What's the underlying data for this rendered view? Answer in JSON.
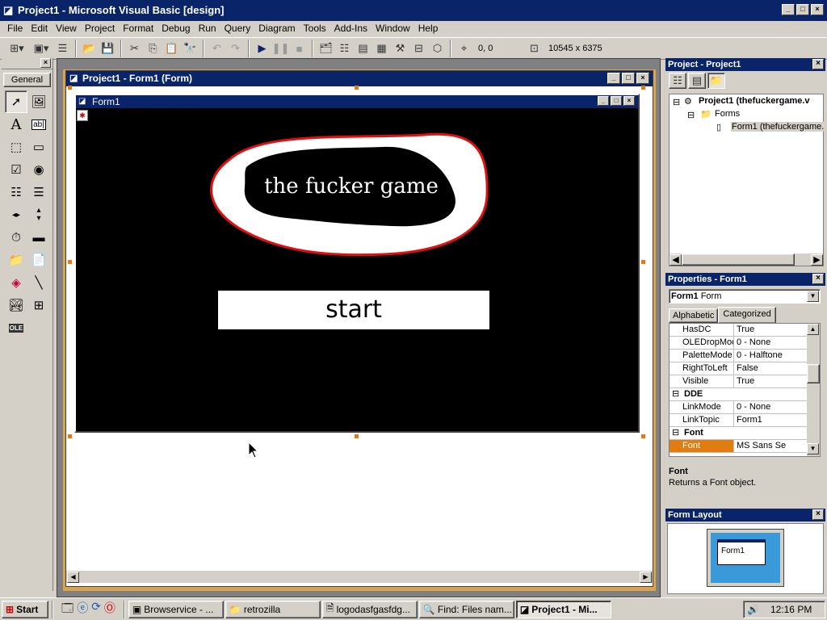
{
  "window": {
    "title": "Project1 - Microsoft Visual Basic [design]"
  },
  "menu": [
    "File",
    "Edit",
    "View",
    "Project",
    "Format",
    "Debug",
    "Run",
    "Query",
    "Diagram",
    "Tools",
    "Add-Ins",
    "Window",
    "Help"
  ],
  "toolbar": {
    "position": "0, 0",
    "size": "10545 x 6375"
  },
  "toolbox": {
    "tab_label": "General",
    "tools": [
      "pointer-icon",
      "picturebox-icon",
      "label-icon",
      "textbox-icon",
      "frame-icon",
      "commandbutton-icon",
      "checkbox-icon",
      "optionbutton-icon",
      "combobox-icon",
      "listbox-icon",
      "hscrollbar-icon",
      "vscrollbar-icon",
      "timer-icon",
      "drivelistbox-icon",
      "dirlistbox-icon",
      "filelistbox-icon",
      "shape-icon",
      "line-icon",
      "image-icon",
      "data-icon",
      "ole-icon"
    ]
  },
  "designer": {
    "window_title": "Project1 - Form1 (Form)",
    "form_caption": "Form1",
    "game_title": "the fucker game",
    "start_label": "start"
  },
  "project_panel": {
    "title": "Project - Project1",
    "tree": {
      "project": "Project1 (thefuckergame.v",
      "folder": "Forms",
      "form": "Form1 (thefuckergame."
    }
  },
  "properties_panel": {
    "title": "Properties - Form1",
    "object_name": "Form1",
    "object_type": "Form",
    "tabs": [
      "Alphabetic",
      "Categorized"
    ],
    "active_tab": "Categorized",
    "rows": [
      {
        "name": "HasDC",
        "value": "True"
      },
      {
        "name": "OLEDropMode",
        "value": "0 - None"
      },
      {
        "name": "PaletteMode",
        "value": "0 - Halftone"
      },
      {
        "name": "RightToLeft",
        "value": "False"
      },
      {
        "name": "Visible",
        "value": "True"
      },
      {
        "name": "DDE",
        "value": "",
        "category": true
      },
      {
        "name": "LinkMode",
        "value": "0 - None"
      },
      {
        "name": "LinkTopic",
        "value": "Form1"
      },
      {
        "name": "Font",
        "value": "",
        "category": true
      },
      {
        "name": "Font",
        "value": "MS Sans Se",
        "selected": true
      }
    ],
    "description_title": "Font",
    "description_text": "Returns a Font object."
  },
  "layout_panel": {
    "title": "Form Layout",
    "form_label": "Form1"
  },
  "taskbar": {
    "start": "Start",
    "buttons": [
      "Browservice - ...",
      "retrozilla",
      "logodasfgasfdg...",
      "Find: Files nam...",
      "Project1 - Mi..."
    ],
    "active_index": 4,
    "clock": "12:16 PM"
  },
  "colors": {
    "titlebar": "#0a246a",
    "selection_handle": "#e07c10",
    "form_background": "#000000",
    "blob_outline": "#e01010"
  }
}
